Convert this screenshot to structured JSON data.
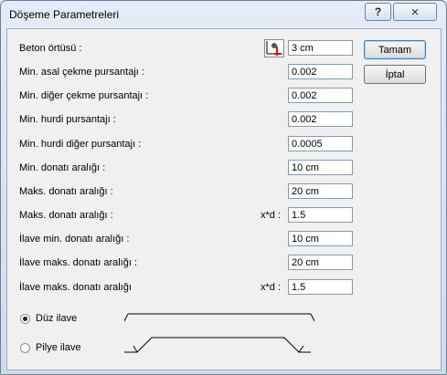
{
  "window": {
    "title": "Döşeme Parametreleri",
    "help_glyph": "?",
    "close_glyph": "×"
  },
  "buttons": {
    "ok": "Tamam",
    "cancel": "İptal"
  },
  "rows": [
    {
      "label": "Beton örtüsü :",
      "value": "3 cm"
    },
    {
      "label": "Min. asal çekme pursantajı :",
      "value": "0.002"
    },
    {
      "label": "Min. diğer çekme pursantajı :",
      "value": "0.002"
    },
    {
      "label": "Min. hurdi pursantajı :",
      "value": "0.002"
    },
    {
      "label": "Min. hurdi diğer pursantajı :",
      "value": "0.0005"
    },
    {
      "label": "Min. donatı aralığı :",
      "value": "10 cm"
    },
    {
      "label": "Maks. donatı aralığı :",
      "value": "20 cm"
    },
    {
      "label": "Maks. donatı aralığı :",
      "value": "1.5",
      "suffix": "x*d :"
    },
    {
      "label": "İlave min. donatı aralığı  :",
      "value": "10 cm"
    },
    {
      "label": "İlave maks. donatı aralığı :",
      "value": "20 cm"
    },
    {
      "label": "İlave maks. donatı aralığı",
      "value": "1.5",
      "suffix": "x*d :"
    }
  ],
  "options": [
    {
      "label": "Düz ilave",
      "selected": true
    },
    {
      "label": "Pilye ilave",
      "selected": false
    }
  ]
}
